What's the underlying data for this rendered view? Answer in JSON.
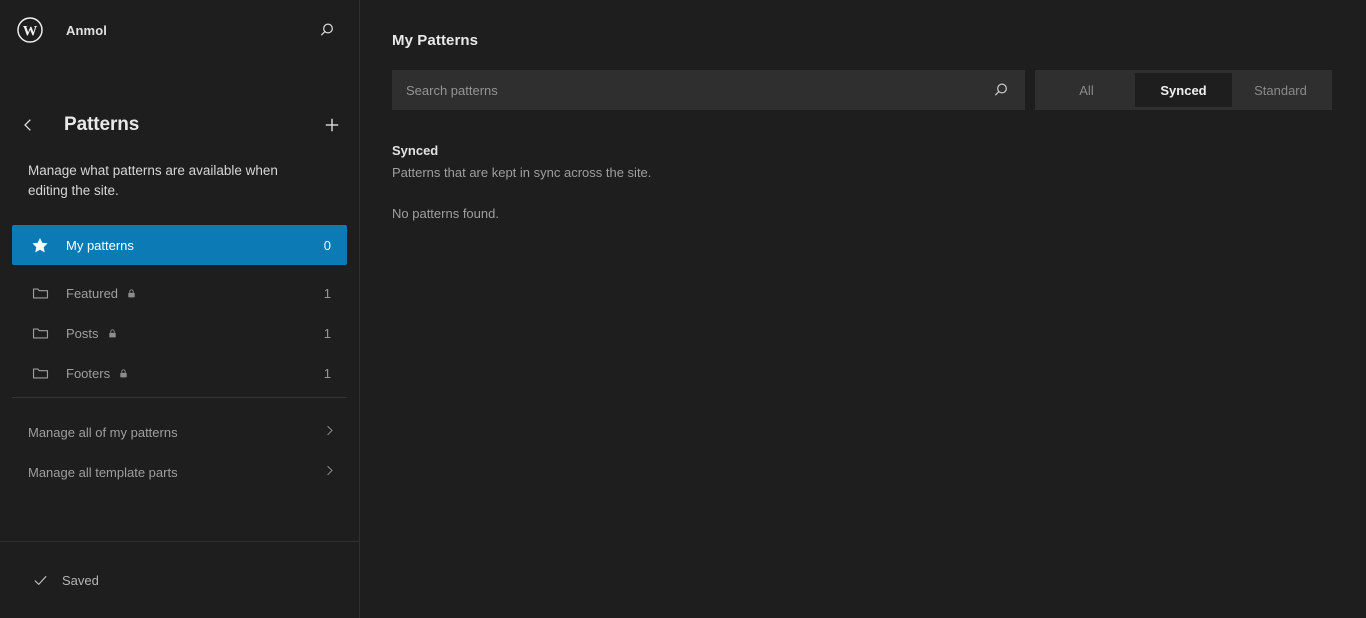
{
  "colors": {
    "accent": "#0b7ab5",
    "sidebar_bg": "#1e1e1e",
    "content_bg": "#1e1e1e",
    "field_bg": "#2f2f2f",
    "text_primary": "#e8e8e8",
    "text_muted": "#9e9e9e"
  },
  "sidebar": {
    "site_hub": {
      "logo_icon": "wordpress-logo-icon",
      "site_title": "Anmol",
      "search_icon": "search-icon"
    },
    "nav": {
      "back_icon": "chevron-left-icon",
      "title": "Patterns",
      "add_icon": "plus-icon",
      "description": "Manage what patterns are available when editing the site."
    },
    "my_patterns": {
      "icon": "star-icon",
      "label": "My patterns",
      "count": "0"
    },
    "categories": [
      {
        "icon": "folder-icon",
        "label": "Featured",
        "locked": true,
        "lock_icon": "lock-icon",
        "count": "1"
      },
      {
        "icon": "folder-icon",
        "label": "Posts",
        "locked": true,
        "lock_icon": "lock-icon",
        "count": "1"
      },
      {
        "icon": "folder-icon",
        "label": "Footers",
        "locked": true,
        "lock_icon": "lock-icon",
        "count": "1"
      }
    ],
    "manage_links": [
      {
        "label": "Manage all of my patterns",
        "chevron_icon": "chevron-right-icon"
      },
      {
        "label": "Manage all template parts",
        "chevron_icon": "chevron-right-icon"
      }
    ],
    "footer": {
      "check_icon": "check-icon",
      "status": "Saved"
    }
  },
  "main": {
    "title": "My Patterns",
    "search": {
      "placeholder": "Search patterns",
      "value": "",
      "icon": "search-icon"
    },
    "sync_filter": {
      "options": [
        "All",
        "Synced",
        "Standard"
      ],
      "selected": "Synced"
    },
    "section": {
      "heading": "Synced",
      "description": "Patterns that are kept in sync across the site.",
      "empty_message": "No patterns found."
    }
  }
}
